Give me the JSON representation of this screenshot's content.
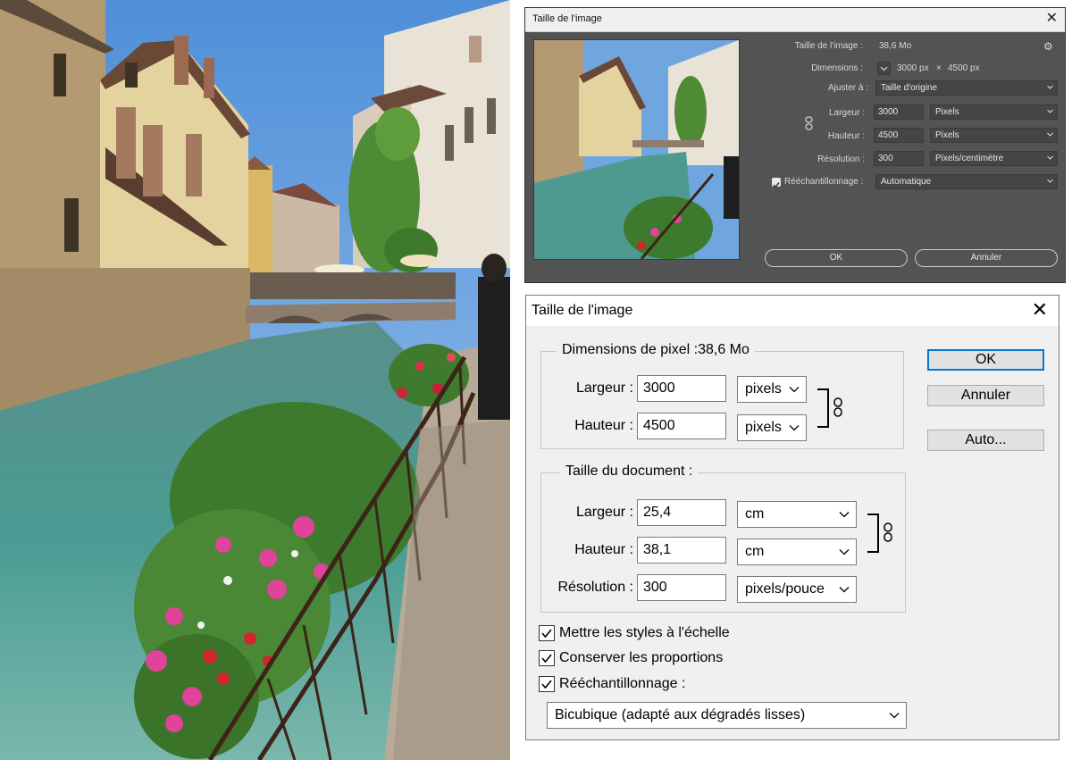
{
  "dark_dialog": {
    "title": "Taille de l'image",
    "image_size_label": "Taille de l'image :",
    "image_size_value": "38,6 Mo",
    "dimensions_label": "Dimensions :",
    "dimensions_width": "3000 px",
    "dimensions_sep": "×",
    "dimensions_height": "4500 px",
    "fit_label": "Ajuster à :",
    "fit_value": "Taille d'origine",
    "width_label": "Largeur :",
    "width_value": "3000",
    "width_unit": "Pixels",
    "height_label": "Hauteur :",
    "height_value": "4500",
    "height_unit": "Pixels",
    "resolution_label": "Résolution :",
    "resolution_value": "300",
    "resolution_unit": "Pixels/centimètre",
    "resample_label": "Rééchantillonnage :",
    "resample_checked": true,
    "resample_value": "Automatique",
    "ok_label": "OK",
    "cancel_label": "Annuler"
  },
  "light_dialog": {
    "title": "Taille de l'image",
    "pixel_group_legend": "Dimensions de pixel :38,6 Mo",
    "px_width_label": "Largeur :",
    "px_width_value": "3000",
    "px_width_unit": "pixels",
    "px_height_label": "Hauteur :",
    "px_height_value": "4500",
    "px_height_unit": "pixels",
    "doc_group_legend": "Taille du document :",
    "doc_width_label": "Largeur :",
    "doc_width_value": "25,4",
    "doc_width_unit": "cm",
    "doc_height_label": "Hauteur :",
    "doc_height_value": "38,1",
    "doc_height_unit": "cm",
    "doc_resolution_label": "Résolution :",
    "doc_resolution_value": "300",
    "doc_resolution_unit": "pixels/pouce",
    "scale_styles_label": "Mettre les styles à l'échelle",
    "scale_styles_checked": true,
    "constrain_label": "Conserver les proportions",
    "constrain_checked": true,
    "resample_label": "Rééchantillonnage :",
    "resample_checked": true,
    "resample_method": "Bicubique (adapté aux dégradés lisses)",
    "ok_label": "OK",
    "cancel_label": "Annuler",
    "auto_label": "Auto..."
  },
  "colors": {
    "dark_bg": "#535353",
    "light_bg": "#f0f0f0",
    "default_button_border": "#0078d7"
  }
}
